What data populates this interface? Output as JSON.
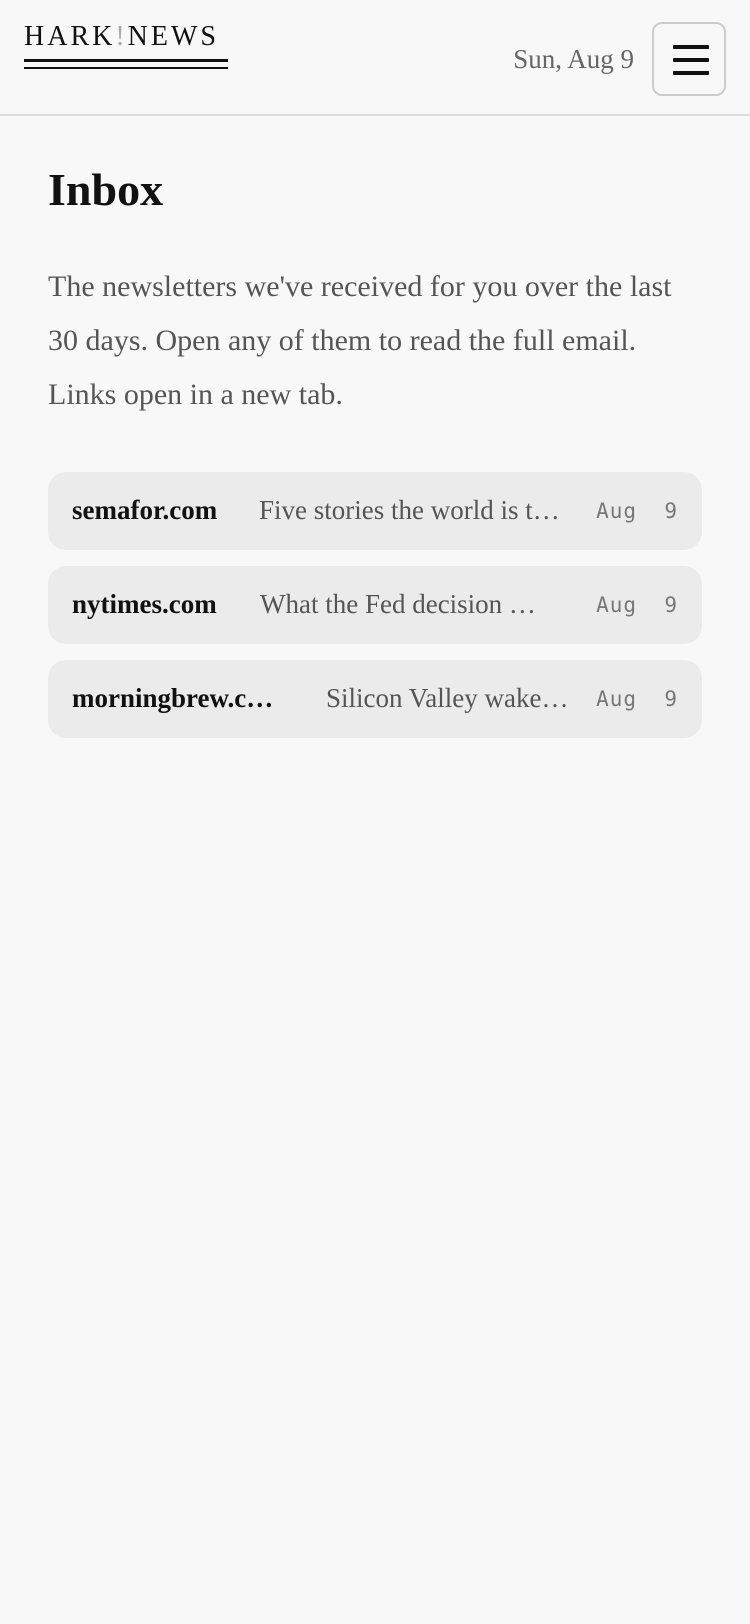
{
  "header": {
    "logo_left": "HARK",
    "logo_bang": "!",
    "logo_right": "NEWS",
    "date": "Sun, Aug 9",
    "menu_icon": "hamburger-menu-icon"
  },
  "main": {
    "title": "Inbox",
    "description": "The newsletters we've received for you over the last 30 days. Open any of them to read the full email. Links open in a new tab.",
    "emails": [
      {
        "sender": "semafor.com",
        "subject": "Five stories the world is t…",
        "date": "Aug 9"
      },
      {
        "sender": "nytimes.com",
        "subject": "What the Fed decision …",
        "date": "Aug 9"
      },
      {
        "sender": "morningbrew.c…",
        "subject": "Silicon Valley wake…",
        "date": "Aug 9"
      }
    ]
  }
}
